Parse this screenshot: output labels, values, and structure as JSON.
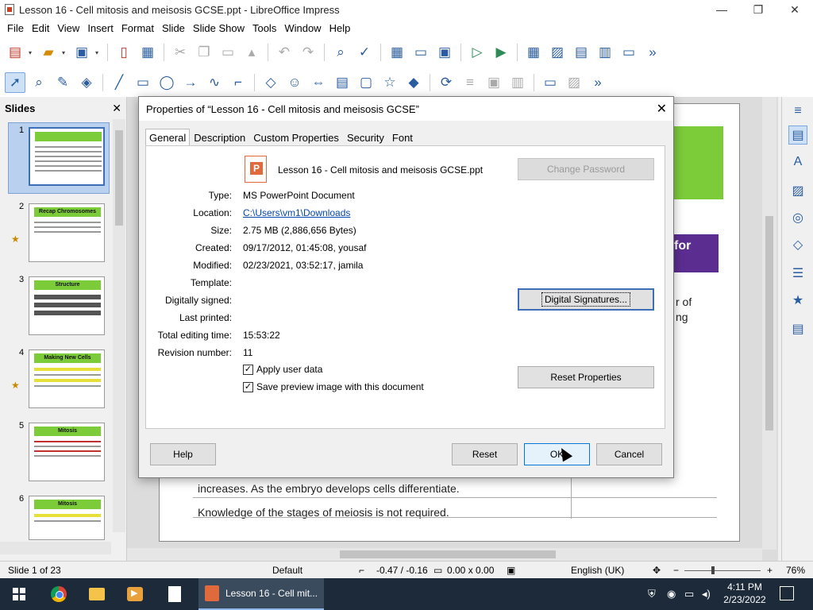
{
  "window": {
    "title": "Lesson 16 - Cell mitosis and meisosis GCSE.ppt - LibreOffice Impress",
    "minimize": "—",
    "maximize": "❐",
    "close": "✕"
  },
  "menu": [
    "File",
    "Edit",
    "View",
    "Insert",
    "Format",
    "Slide",
    "Slide Show",
    "Tools",
    "Window",
    "Help"
  ],
  "toolbar": {
    "more": "»",
    "dropdown": "▾"
  },
  "slides_pane": {
    "title": "Slides",
    "close": "✕",
    "thumbnails": [
      {
        "num": "1",
        "title": "",
        "active": true
      },
      {
        "num": "2",
        "title": "Recap Chromosomes"
      },
      {
        "num": "3",
        "title": "Structure"
      },
      {
        "num": "4",
        "title": "Making New Cells"
      },
      {
        "num": "5",
        "title": "Mitosis"
      },
      {
        "num": "6",
        "title": "Mitosis"
      }
    ]
  },
  "slide_content": {
    "side_text_1": "r of",
    "side_text_2": "ng",
    "purple_text": "for",
    "line1": "increases. As the embryo develops cells differentiate.",
    "line2": "Knowledge of the stages of meiosis is not required."
  },
  "status": {
    "slide": "Slide 1 of 23",
    "layout": "Default",
    "position": "-0.47 / -0.16",
    "size": "0.00 x 0.00",
    "language": "English (UK)",
    "zoom": "76%",
    "zoom_minus": "−",
    "zoom_plus": "+"
  },
  "dialog": {
    "title": "Properties of “Lesson 16 - Cell mitosis and meisosis GCSE”",
    "close": "✕",
    "tabs": [
      "General",
      "Description",
      "Custom Properties",
      "Security",
      "Font"
    ],
    "file_name": "Lesson 16 - Cell mitosis and meisosis GCSE.ppt",
    "fields": [
      {
        "label": "Type:",
        "value": "MS PowerPoint Document"
      },
      {
        "label": "Location:",
        "value": "C:\\Users\\vm1\\Downloads",
        "link": true
      },
      {
        "label": "Size:",
        "value": "2.75 MB (2,886,656 Bytes)"
      },
      {
        "label": "Created:",
        "value": "09/17/2012, 01:45:08, yousaf"
      },
      {
        "label": "Modified:",
        "value": "02/23/2021, 03:52:17, jamila"
      },
      {
        "label": "Template:",
        "value": ""
      },
      {
        "label": "Digitally signed:",
        "value": ""
      },
      {
        "label": "Last printed:",
        "value": ""
      },
      {
        "label": "Total editing time:",
        "value": "15:53:22"
      },
      {
        "label": "Revision number:",
        "value": "11"
      }
    ],
    "check_apply": "Apply user data",
    "check_preview": "Save preview image with this document",
    "check_mark": "✓",
    "btn_change_password": "Change Password",
    "btn_digital_signatures": "Digital Signatures...",
    "btn_reset_properties": "Reset Properties",
    "btn_help": "Help",
    "btn_reset": "Reset",
    "btn_ok": "OK",
    "btn_cancel": "Cancel"
  },
  "taskbar": {
    "active_task": "Lesson 16 - Cell mit...",
    "time": "4:11 PM",
    "date": "2/23/2022"
  }
}
